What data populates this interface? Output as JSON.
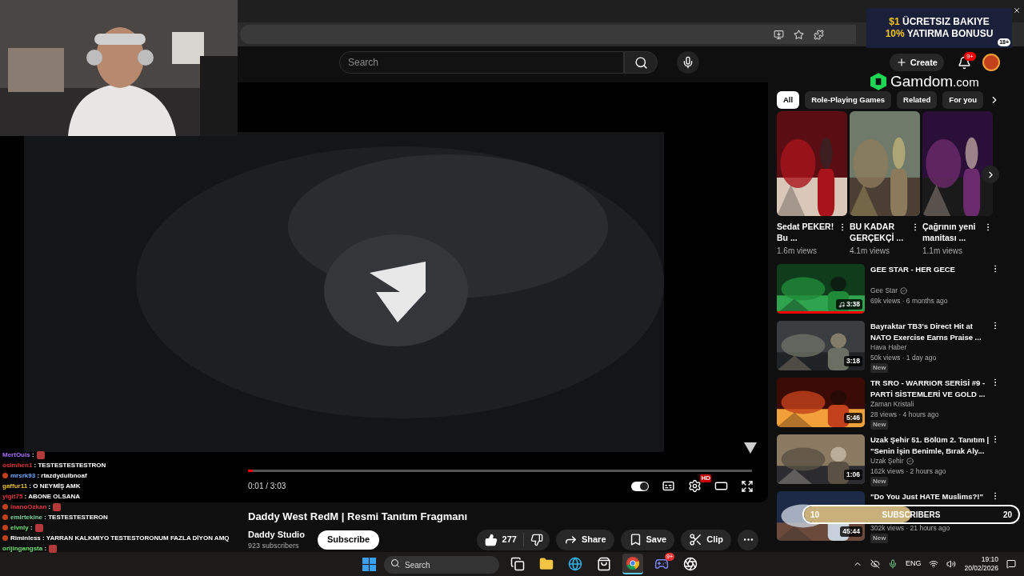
{
  "header": {
    "search": {
      "placeholder": "Search"
    },
    "create_button": "Create",
    "notifications_badge": "9+"
  },
  "ad": {
    "line_1_highlight": "$1",
    "line_1": "ÜCRETSIZ BAKIYE",
    "line_2_highlight": "10%",
    "line_2": "YATIRMA BONUSU",
    "age_badge": "18+"
  },
  "sponsor": {
    "name": "Gamdom",
    "domain": ".com"
  },
  "player": {
    "progress": {
      "level": 0.01
    },
    "time": "0:01 / 3:03",
    "autoplay": {
      "on": true
    },
    "quality_badge": "HD"
  },
  "video": {
    "title": "Daddy West RedM | Resmi Tanıtım Fragmanı",
    "channel": "Daddy Studio",
    "subscribers": "923 subscribers",
    "subscribe_button": "Subscribe",
    "likes": "277",
    "actions": [
      {
        "kind": "share",
        "label": "Share"
      },
      {
        "kind": "save",
        "label": "Save"
      },
      {
        "kind": "clip",
        "label": "Clip"
      }
    ]
  },
  "chips": [
    {
      "label": "All",
      "selected": true
    },
    {
      "label": "Role-Playing Games",
      "selected": false
    },
    {
      "label": "Related",
      "selected": false
    },
    {
      "label": "For you",
      "selected": false
    }
  ],
  "shorts": [
    {
      "title": "Sedat PEKER! Bu ...",
      "views": "1.6m views"
    },
    {
      "title": "BU KADAR GERÇEKÇİ ...",
      "views": "4.1m views"
    },
    {
      "title": "Çağrının yeni manitası ...",
      "views": "1.1m views"
    }
  ],
  "recommendations": [
    {
      "title": "GEE STAR - HER GECE",
      "channel": "Gee Star",
      "verified": true,
      "meta": "69k views · 6 months ago",
      "duration": "3:38",
      "music": true,
      "watch_progress": {
        "level": 1
      }
    },
    {
      "title": "Bayraktar TB3's Direct Hit at NATO Exercise Earns Praise ...",
      "channel": "Hava Haber",
      "verified": false,
      "meta": "50k views · 1 day ago",
      "badge": "New",
      "duration": "3:18",
      "music": false
    },
    {
      "title": "TR SRO - WARRIOR SERİSİ #9 - PARTİ SİSTEMLERİ VE GOLD ...",
      "channel": "Zaman Kristali",
      "verified": false,
      "meta": "28 views · 4 hours ago",
      "badge": "New",
      "duration": "5:46",
      "music": false
    },
    {
      "title": "Uzak Şehir 51. Bölüm 2. Tanıtım | \"Senin İşin Benimle, Bırak Aly...",
      "channel": "Uzak Şehir",
      "verified": true,
      "meta": "162k views · 2 hours ago",
      "badge": "New",
      "duration": "1:06",
      "music": false
    },
    {
      "title": "\"Do You Just HATE Muslims?!\"",
      "meta": "302k views · 21 hours ago",
      "badge": "New",
      "duration": "45:44",
      "music": false
    }
  ],
  "subscriber_goal": {
    "current": "10",
    "label": "SUBSCRIBERS",
    "target": "20",
    "level": 0.5
  },
  "chat": [
    {
      "user": "MertOuis",
      "color": "#a970ff",
      "badge": false,
      "kind": "emote",
      "text": ":"
    },
    {
      "user": "osimhen1",
      "color": "#e0383e",
      "badge": false,
      "kind": "text",
      "text": ": TESTESTESTESTRON"
    },
    {
      "user": "mrsrk93",
      "color": "#6fa8ff",
      "badge": true,
      "kind": "text",
      "text": ": rtazdyduibnoaf"
    },
    {
      "user": "gaffur11",
      "color": "#e8c033",
      "badge": false,
      "kind": "text",
      "text": ": O NEYMİŞ AMK"
    },
    {
      "user": "yigit75",
      "color": "#e0383e",
      "badge": false,
      "kind": "text",
      "text": ": ABONE OLSANA"
    },
    {
      "user": "inanoOzkan",
      "color": "#e0383e",
      "badge": true,
      "kind": "emote",
      "text": ":"
    },
    {
      "user": "emirtekine",
      "color": "#7fd6a0",
      "badge": true,
      "kind": "text",
      "text": ": TESTESTESTERON"
    },
    {
      "user": "elvnly",
      "color": "#6fe06f",
      "badge": true,
      "kind": "emote",
      "text": ":"
    },
    {
      "user": "Riminless",
      "color": "#ffffff",
      "badge": true,
      "kind": "text",
      "text": ": YARRAN KALKMIYO TESTESTORONUM FAZLA DİYON AMQ"
    },
    {
      "user": "orijingangsta",
      "color": "#6fe06f",
      "badge": false,
      "kind": "emote",
      "text": ":"
    }
  ],
  "taskbar": {
    "search": {
      "placeholder": "Search"
    },
    "apps": [
      {
        "kind": "taskview",
        "selected": false
      },
      {
        "kind": "files",
        "selected": false
      },
      {
        "kind": "edge",
        "selected": false
      },
      {
        "kind": "store",
        "selected": false
      },
      {
        "kind": "chrome",
        "selected": true
      },
      {
        "kind": "discord",
        "selected": false,
        "badge": "9+"
      },
      {
        "kind": "obs",
        "selected": false
      }
    ],
    "language": "ENG",
    "time": "19:10",
    "date": "20/02/2026"
  }
}
